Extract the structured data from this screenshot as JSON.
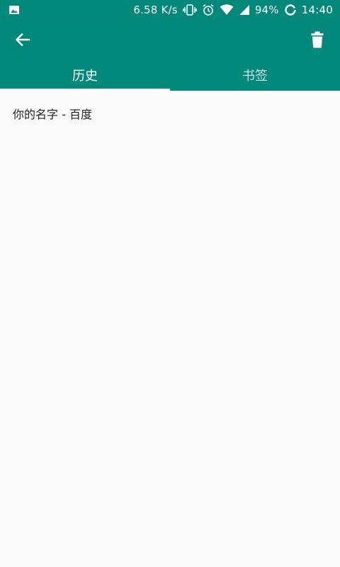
{
  "status_bar": {
    "net_speed": "6.58 K/s",
    "battery": "94%",
    "time": "14:40",
    "icons": [
      "image-icon",
      "vibrate-icon",
      "alarm-icon",
      "wifi-icon",
      "signal-icon",
      "battery-icon"
    ]
  },
  "app_bar": {
    "back_icon": "arrow-back-icon",
    "delete_icon": "trash-icon"
  },
  "tabs": [
    {
      "label": "历史",
      "selected": true
    },
    {
      "label": "书签",
      "selected": false
    }
  ],
  "history": {
    "items": [
      {
        "title": "你的名字 - 百度"
      }
    ]
  },
  "colors": {
    "primary": "#00897b",
    "background": "#fafafa",
    "text": "#212121",
    "on_primary": "#ffffff"
  }
}
